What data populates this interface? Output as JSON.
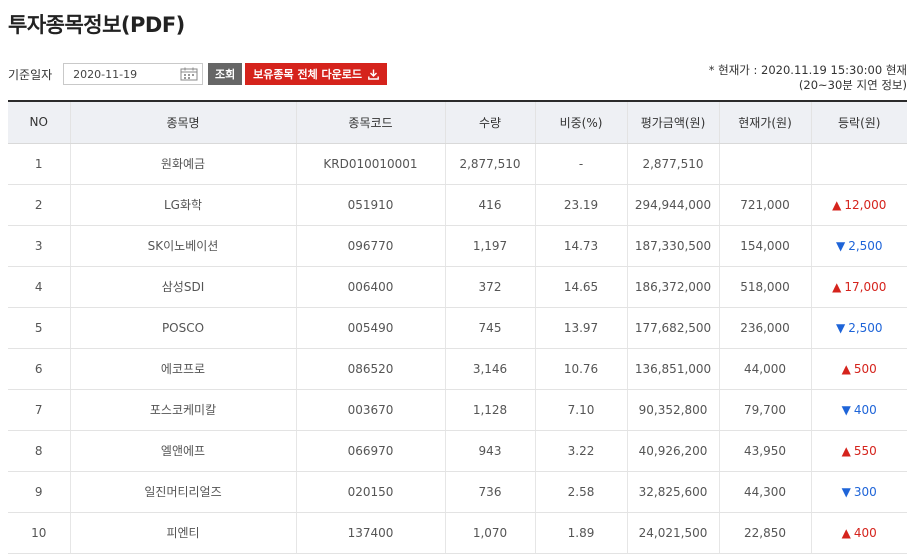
{
  "page": {
    "title": "투자종목정보(PDF)"
  },
  "toolbar": {
    "date_label": "기준일자",
    "date_value": "2020-11-19",
    "search_label": "조회",
    "download_label": "보유종목 전체 다운로드"
  },
  "price_note": {
    "line1": "* 현재가 : 2020.11.19 15:30:00 현재",
    "line2": "(20~30분 지연 정보)"
  },
  "table": {
    "headers": [
      "NO",
      "종목명",
      "종목코드",
      "수량",
      "비중(%)",
      "평가금액(원)",
      "현재가(원)",
      "등락(원)"
    ],
    "rows": [
      {
        "no": "1",
        "name": "원화예금",
        "code": "KRD010010001",
        "qty": "2,877,510",
        "weight": "-",
        "value": "2,877,510",
        "price": "",
        "change": "",
        "dir": ""
      },
      {
        "no": "2",
        "name": "LG화학",
        "code": "051910",
        "qty": "416",
        "weight": "23.19",
        "value": "294,944,000",
        "price": "721,000",
        "change": "12,000",
        "dir": "up"
      },
      {
        "no": "3",
        "name": "SK이노베이션",
        "code": "096770",
        "qty": "1,197",
        "weight": "14.73",
        "value": "187,330,500",
        "price": "154,000",
        "change": "2,500",
        "dir": "down"
      },
      {
        "no": "4",
        "name": "삼성SDI",
        "code": "006400",
        "qty": "372",
        "weight": "14.65",
        "value": "186,372,000",
        "price": "518,000",
        "change": "17,000",
        "dir": "up"
      },
      {
        "no": "5",
        "name": "POSCO",
        "code": "005490",
        "qty": "745",
        "weight": "13.97",
        "value": "177,682,500",
        "price": "236,000",
        "change": "2,500",
        "dir": "down"
      },
      {
        "no": "6",
        "name": "에코프로",
        "code": "086520",
        "qty": "3,146",
        "weight": "10.76",
        "value": "136,851,000",
        "price": "44,000",
        "change": "500",
        "dir": "up"
      },
      {
        "no": "7",
        "name": "포스코케미칼",
        "code": "003670",
        "qty": "1,128",
        "weight": "7.10",
        "value": "90,352,800",
        "price": "79,700",
        "change": "400",
        "dir": "down"
      },
      {
        "no": "8",
        "name": "엘앤에프",
        "code": "066970",
        "qty": "943",
        "weight": "3.22",
        "value": "40,926,200",
        "price": "43,950",
        "change": "550",
        "dir": "up"
      },
      {
        "no": "9",
        "name": "일진머티리얼즈",
        "code": "020150",
        "qty": "736",
        "weight": "2.58",
        "value": "32,825,600",
        "price": "44,300",
        "change": "300",
        "dir": "down"
      },
      {
        "no": "10",
        "name": "피엔티",
        "code": "137400",
        "qty": "1,070",
        "weight": "1.89",
        "value": "24,021,500",
        "price": "22,850",
        "change": "400",
        "dir": "up"
      }
    ]
  },
  "icons": {
    "calendar": "calendar-icon",
    "download": "download-icon",
    "up_arrow": "▲",
    "down_arrow": "▼"
  },
  "colors": {
    "up": "#d5231c",
    "down": "#1e64d8",
    "download_button": "#d5231c",
    "search_button": "#666666"
  }
}
